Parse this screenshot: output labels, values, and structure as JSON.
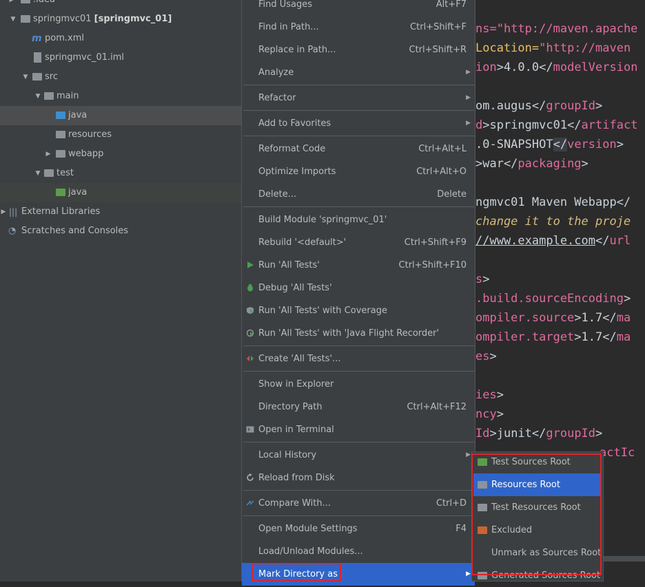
{
  "tree": {
    "items": [
      {
        "label": ".idea"
      },
      {
        "label": "springmvc01",
        "suffix": "[springmvc_01]"
      },
      {
        "label": "pom.xml"
      },
      {
        "label": "springmvc_01.iml"
      },
      {
        "label": "src"
      },
      {
        "label": "main"
      },
      {
        "label": "java"
      },
      {
        "label": "resources"
      },
      {
        "label": "webapp"
      },
      {
        "label": "test"
      },
      {
        "label": "java"
      },
      {
        "label": "External Libraries"
      },
      {
        "label": "Scratches and Consoles"
      }
    ]
  },
  "menu": {
    "items": [
      {
        "label": "Find Usages",
        "shortcut": "Alt+F7"
      },
      {
        "label": "Find in Path...",
        "shortcut": "Ctrl+Shift+F"
      },
      {
        "label": "Replace in Path...",
        "shortcut": "Ctrl+Shift+R"
      },
      {
        "label": "Analyze",
        "shortcut": ""
      },
      {
        "label": "Refactor",
        "shortcut": ""
      },
      {
        "label": "Add to Favorites",
        "shortcut": ""
      },
      {
        "label": "Reformat Code",
        "shortcut": "Ctrl+Alt+L"
      },
      {
        "label": "Optimize Imports",
        "shortcut": "Ctrl+Alt+O"
      },
      {
        "label": "Delete...",
        "shortcut": "Delete"
      },
      {
        "label": "Build Module 'springmvc_01'",
        "shortcut": ""
      },
      {
        "label": "Rebuild '<default>'",
        "shortcut": "Ctrl+Shift+F9"
      },
      {
        "label": "Run 'All Tests'",
        "shortcut": "Ctrl+Shift+F10"
      },
      {
        "label": "Debug 'All Tests'",
        "shortcut": ""
      },
      {
        "label": "Run 'All Tests' with Coverage",
        "shortcut": ""
      },
      {
        "label": "Run 'All Tests' with 'Java Flight Recorder'",
        "shortcut": ""
      },
      {
        "label": "Create 'All Tests'...",
        "shortcut": ""
      },
      {
        "label": "Show in Explorer",
        "shortcut": ""
      },
      {
        "label": "Directory Path",
        "shortcut": "Ctrl+Alt+F12"
      },
      {
        "label": "Open in Terminal",
        "shortcut": ""
      },
      {
        "label": "Local History",
        "shortcut": ""
      },
      {
        "label": "Reload from Disk",
        "shortcut": ""
      },
      {
        "label": "Compare With...",
        "shortcut": "Ctrl+D"
      },
      {
        "label": "Open Module Settings",
        "shortcut": "F4"
      },
      {
        "label": "Load/Unload Modules...",
        "shortcut": ""
      },
      {
        "label": "Mark Directory as",
        "shortcut": ""
      }
    ]
  },
  "submenu": {
    "items": [
      {
        "label": "Test Sources Root"
      },
      {
        "label": "Resources Root"
      },
      {
        "label": "Test Resources Root"
      },
      {
        "label": "Excluded"
      },
      {
        "label": "Unmark as Sources Root"
      },
      {
        "label": "Generated Sources Root"
      }
    ]
  },
  "editor": {
    "lines": [
      {
        "a": "ns=",
        "b": "\"http://maven.apache"
      },
      {
        "a": "Location=",
        "b": "\"http://maven"
      },
      {
        "a": "ion",
        "b": ">4.0.0</",
        "c": "modelVersion"
      },
      {
        "a": "om.augus</",
        "b": "groupId",
        "c": ">"
      },
      {
        "a": "d",
        "b": ">springmvc01</",
        "c": "artifact"
      },
      {
        "a": ".0-SNAPSHOT",
        "b": "</",
        "c": "version",
        "d": ">"
      },
      {
        "a": ">war</",
        "b": "packaging",
        "c": ">"
      },
      {
        "a": "ngmvc01 Maven Webapp</",
        "b": ""
      },
      {
        "a": " change it to the proje"
      },
      {
        "a": "//www.example.com",
        "b": "</",
        "c": "url"
      },
      {
        "a": "s",
        "b": ">"
      },
      {
        "a": ".build.sourceEncoding",
        "b": ">"
      },
      {
        "a": "ompiler.source",
        "b": ">1.7</",
        "c": "ma"
      },
      {
        "a": "ompiler.target",
        "b": ">1.7</",
        "c": "ma"
      },
      {
        "a": "es",
        "b": ">"
      },
      {
        "a": "ies",
        "b": ">"
      },
      {
        "a": "ncy",
        "b": ">"
      },
      {
        "a": "Id",
        "b": ">junit</",
        "c": "groupId",
        "d": ">"
      },
      {
        "a": "actIc"
      }
    ]
  },
  "colors": {
    "menu_bg": "#3c3f41",
    "selection": "#2f65ca",
    "highlight_box": "#e0242b",
    "editor_bg": "#2b2b2b"
  }
}
